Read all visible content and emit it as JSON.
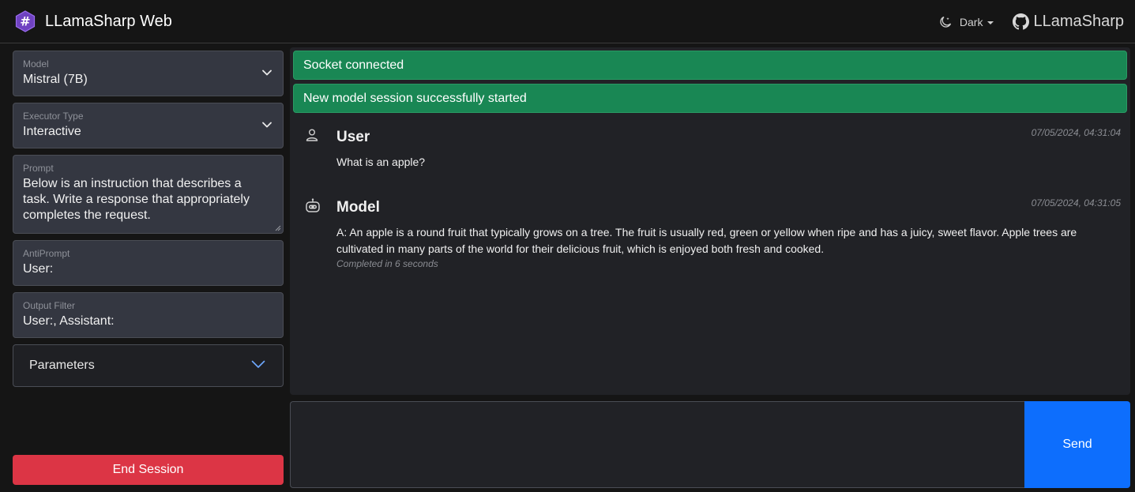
{
  "header": {
    "title": "LLamaSharp Web",
    "logo_icon": "hash-hexagon-icon",
    "theme_label": "Dark",
    "github_label": "LLamaSharp"
  },
  "colors": {
    "background": "#151515",
    "panel": "#343741",
    "success": "#198754",
    "danger": "#dc3545",
    "primary": "#0d6efd",
    "logo": "#6f42c1"
  },
  "sidebar": {
    "model": {
      "label": "Model",
      "value": "Mistral (7B)"
    },
    "executor": {
      "label": "Executor Type",
      "value": "Interactive"
    },
    "prompt": {
      "label": "Prompt",
      "value": "Below is an instruction that describes a task. Write a response that appropriately completes the request."
    },
    "antiprompt": {
      "label": "AntiPrompt",
      "value": "User:"
    },
    "output_filter": {
      "label": "Output Filter",
      "value": "User:, Assistant:"
    },
    "parameters_label": "Parameters",
    "end_session_label": "End Session"
  },
  "chat": {
    "alerts": [
      "Socket connected",
      "New model session successfully started"
    ],
    "messages": [
      {
        "author": "User",
        "time": "07/05/2024, 04:31:04",
        "text": "What is an apple?",
        "icon": "user-icon"
      },
      {
        "author": "Model",
        "time": "07/05/2024, 04:31:05",
        "text": "A: An apple is a round fruit that typically grows on a tree. The fruit is usually red, green or yellow when ripe and has a juicy, sweet flavor. Apple trees are cultivated in many parts of the world for their delicious fruit, which is enjoyed both fresh and cooked.",
        "meta": "Completed in 6 seconds",
        "icon": "robot-icon"
      }
    ]
  },
  "composer": {
    "input_value": "",
    "send_label": "Send"
  }
}
